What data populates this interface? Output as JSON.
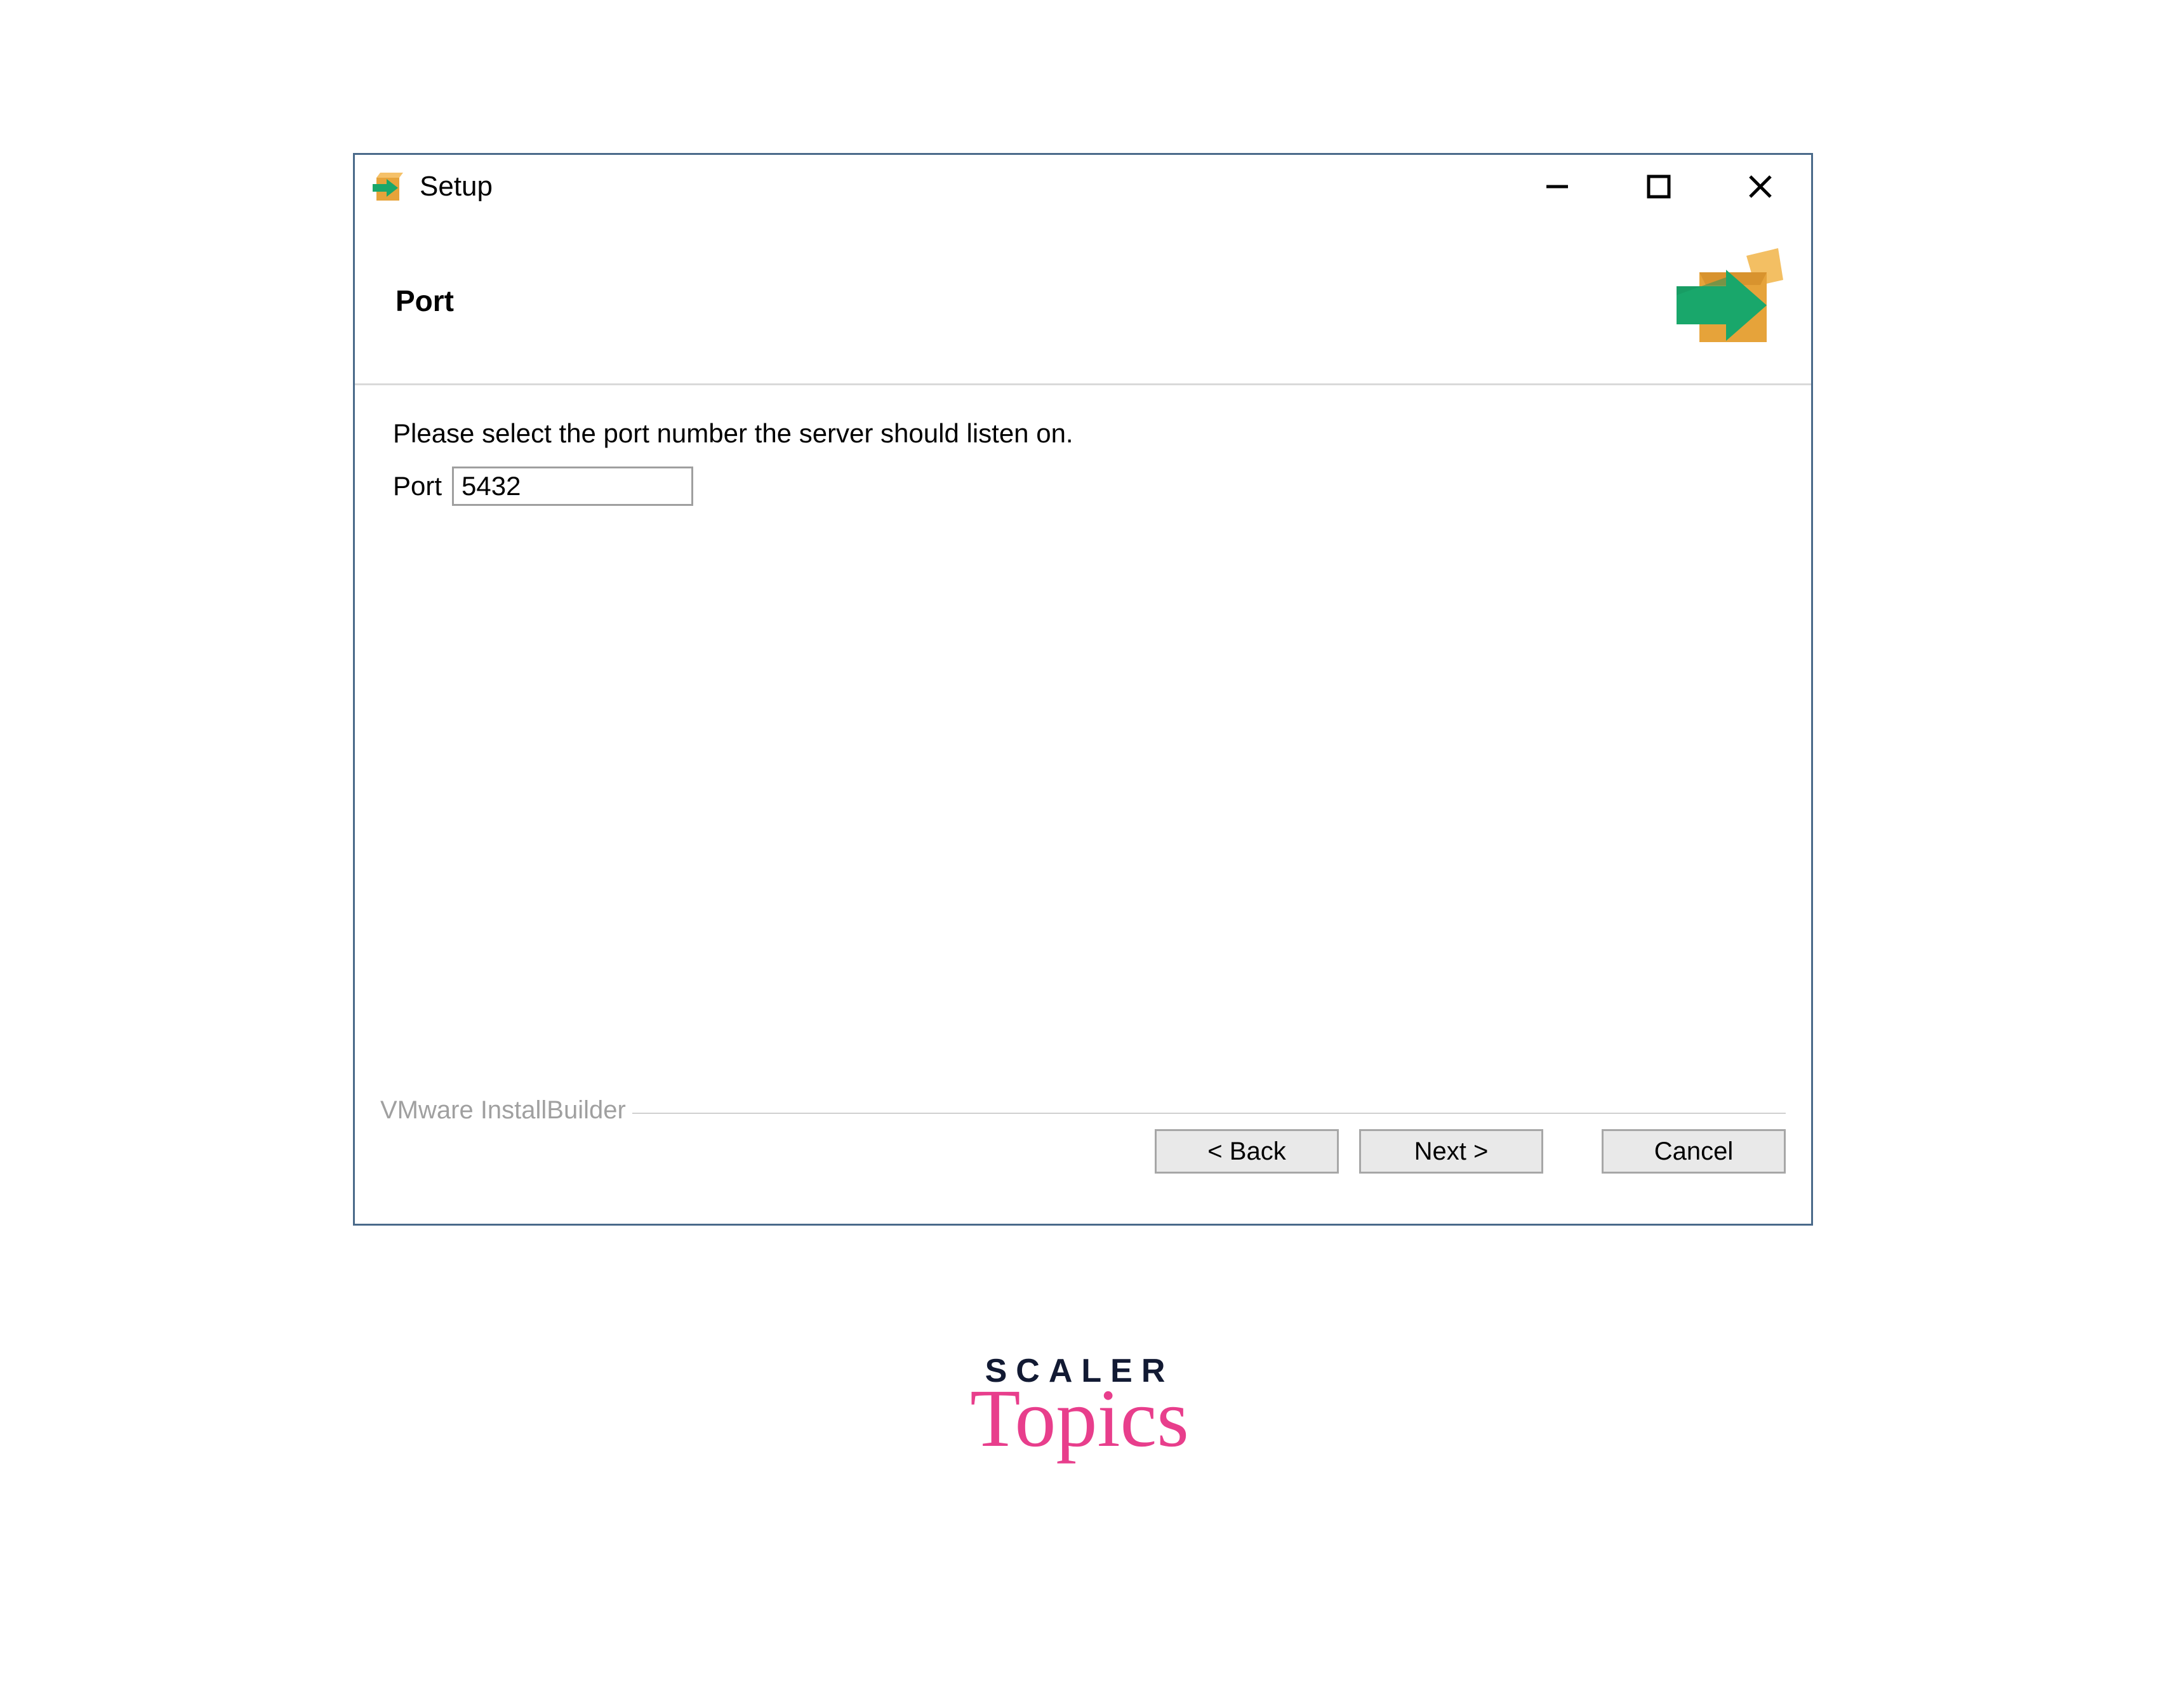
{
  "window": {
    "title": "Setup"
  },
  "header": {
    "title": "Port"
  },
  "body": {
    "instruction": "Please select the port number the server should listen on.",
    "port_label": "Port",
    "port_value": "5432"
  },
  "footer": {
    "brand": "VMware InstallBuilder",
    "back_label": "< Back",
    "next_label": "Next >",
    "cancel_label": "Cancel"
  },
  "watermark": {
    "line1": "SCALER",
    "line2": "Topics"
  }
}
